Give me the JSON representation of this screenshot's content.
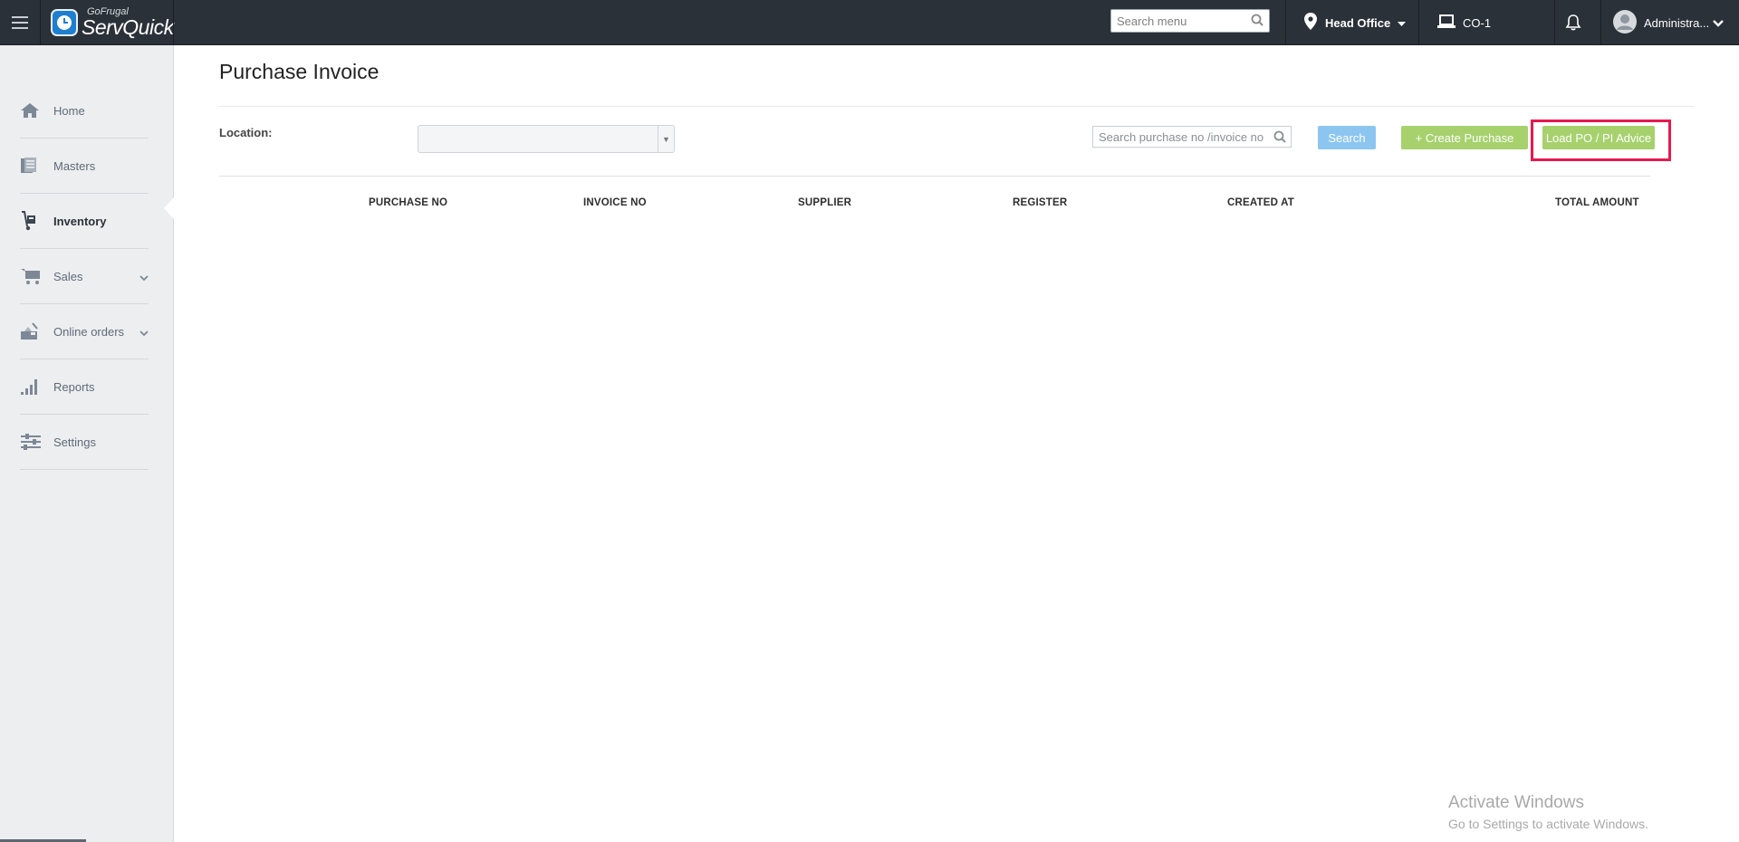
{
  "app": {
    "logo_small": "GoFrugal",
    "logo_big": "ServQuick"
  },
  "topbar": {
    "search_placeholder": "Search menu",
    "location_label": "Head Office",
    "counter_label": "CO-1",
    "user_label": "Administra..."
  },
  "sidebar": {
    "items": [
      {
        "label": "Home",
        "icon": "home-icon"
      },
      {
        "label": "Masters",
        "icon": "masters-icon"
      },
      {
        "label": "Inventory",
        "icon": "inventory-icon",
        "active": true
      },
      {
        "label": "Sales",
        "icon": "cart-icon",
        "has_submenu": true
      },
      {
        "label": "Online orders",
        "icon": "online-orders-icon",
        "has_submenu": true
      },
      {
        "label": "Reports",
        "icon": "reports-icon"
      },
      {
        "label": "Settings",
        "icon": "settings-icon"
      }
    ]
  },
  "main": {
    "title": "Purchase Invoice",
    "location_label": "Location:",
    "location_value": "",
    "search_placeholder": "Search purchase no /invoice no",
    "search_button": "Search",
    "create_button": "+ Create Purchase",
    "load_button": "Load PO / PI Advice",
    "table_headers": [
      "PURCHASE NO",
      "INVOICE NO",
      "SUPPLIER",
      "REGISTER",
      "CREATED AT",
      "TOTAL AMOUNT"
    ],
    "rows": []
  },
  "watermark": {
    "line1": "Activate Windows",
    "line2": "Go to Settings to activate Windows."
  },
  "colors": {
    "topbar": "#2b3138",
    "sidebar": "#edeef0",
    "accent_green": "#a6d16d",
    "accent_blue": "#8cc6f0",
    "highlight": "#e8194f"
  }
}
